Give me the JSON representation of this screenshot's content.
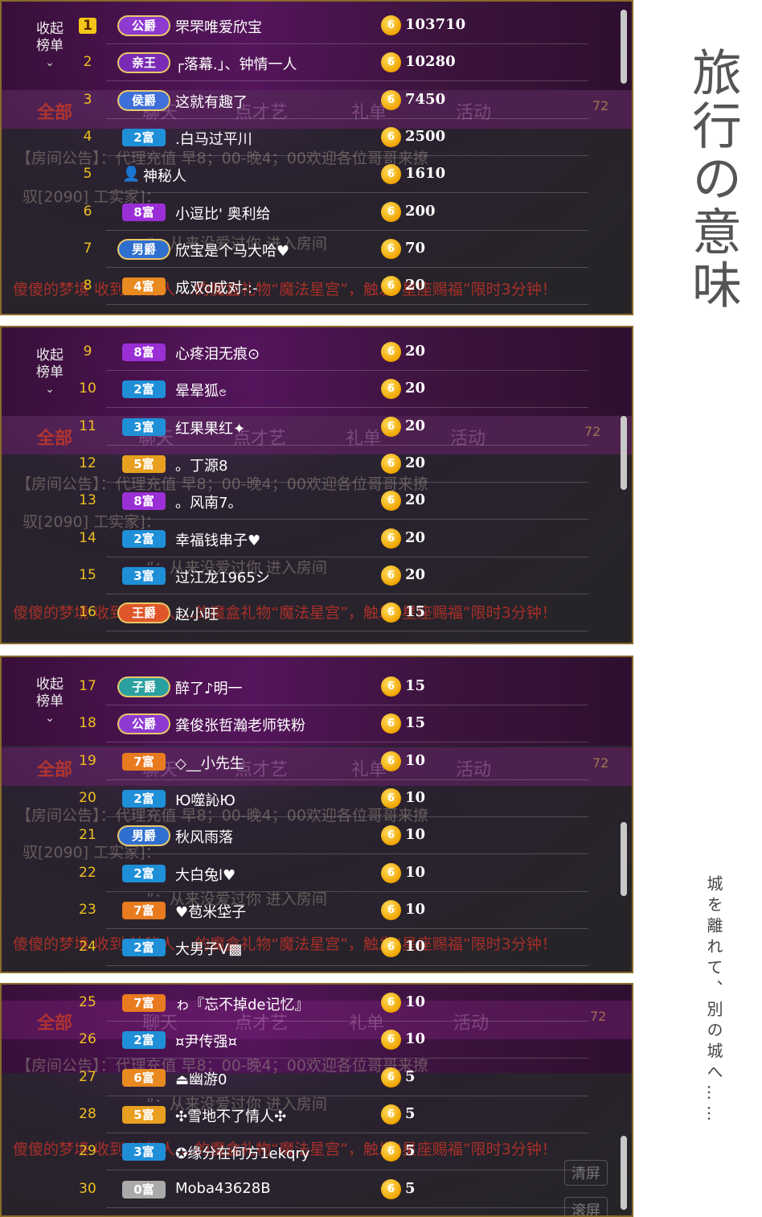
{
  "side": {
    "title": "旅行の意味",
    "subtitle": "城を離れて、別の城へ……"
  },
  "collapse": {
    "line1": "收起",
    "line2": "榜单",
    "chevron": "chevron-down-icon"
  },
  "background_text": {
    "tab_all": "全部",
    "tabs": [
      "聊天",
      "点才艺",
      "礼单",
      "活动"
    ],
    "car_count": "72",
    "announcement": "【房间公告】：代理充值 早8；00-晚4；00欢迎各位哥哥来撩",
    "notice_partial": "驭[2090] 工实家]：",
    "enter_msg": "”：从来没爱过你 进入房间",
    "gift_msg": "傻傻的梦境 收到 神秘人 ...的魔盒礼物“魔法星宫”，触发“星座赐福”限时3分钟！",
    "clear_btn": "清屏",
    "scroll_btn": "滚屏"
  },
  "rows": [
    {
      "rank": "1",
      "badge": "公爵",
      "type": "noble",
      "color": "#8e3ad0",
      "name": "罘罘唯爱欣宝",
      "amount": "103710"
    },
    {
      "rank": "2",
      "badge": "亲王",
      "type": "noble",
      "color": "#7a2bb5",
      "name": "┌落幕.」、钟情一人",
      "amount": "10280"
    },
    {
      "rank": "3",
      "badge": "侯爵",
      "type": "noble",
      "color": "#3f6fd8",
      "name": "这就有趣了",
      "amount": "7450"
    },
    {
      "rank": "4",
      "badge": "2富",
      "type": "rich",
      "color": "#1f8fd8",
      "name": ".白马过平川",
      "amount": "2500"
    },
    {
      "rank": "5",
      "badge": "",
      "type": "mystery",
      "color": "",
      "name": "神秘人",
      "amount": "1610"
    },
    {
      "rank": "6",
      "badge": "8富",
      "type": "rich",
      "color": "#9b2fd6",
      "name": "小逗比' 奥利给",
      "amount": "200"
    },
    {
      "rank": "7",
      "badge": "男爵",
      "type": "noble",
      "color": "#2f6fd0",
      "name": "欣宝是个马大哈♥",
      "amount": "70"
    },
    {
      "rank": "8",
      "badge": "4富",
      "type": "rich",
      "color": "#e88a20",
      "name": "成双d成对-:-",
      "amount": "20"
    },
    {
      "rank": "9",
      "badge": "8富",
      "type": "rich",
      "color": "#9b2fd6",
      "name": "心疼泪无痕⊙",
      "amount": "20"
    },
    {
      "rank": "10",
      "badge": "2富",
      "type": "rich",
      "color": "#1f8fd8",
      "name": "晕晕狐ၔ",
      "amount": "20"
    },
    {
      "rank": "11",
      "badge": "3富",
      "type": "rich",
      "color": "#1f8fd8",
      "name": "红果果红✦",
      "amount": "20"
    },
    {
      "rank": "12",
      "badge": "5富",
      "type": "rich",
      "color": "#e8a020",
      "name": "。丁源8",
      "amount": "20"
    },
    {
      "rank": "13",
      "badge": "8富",
      "type": "rich",
      "color": "#9b2fd6",
      "name": "。风南7。",
      "amount": "20"
    },
    {
      "rank": "14",
      "badge": "2富",
      "type": "rich",
      "color": "#1f8fd8",
      "name": "幸福钱串子♥",
      "amount": "20"
    },
    {
      "rank": "15",
      "badge": "3富",
      "type": "rich",
      "color": "#1f8fd8",
      "name": "过江龙1965シ",
      "amount": "20"
    },
    {
      "rank": "16",
      "badge": "王爵",
      "type": "noble",
      "color": "#e0562a",
      "name": "赵小旺",
      "amount": "15"
    },
    {
      "rank": "17",
      "badge": "子爵",
      "type": "noble",
      "color": "#2aa0a0",
      "name": "醉了♪明一",
      "amount": "15"
    },
    {
      "rank": "18",
      "badge": "公爵",
      "type": "noble",
      "color": "#8e3ad0",
      "name": "龚俊张哲瀚老师铁粉",
      "amount": "15"
    },
    {
      "rank": "19",
      "badge": "7富",
      "type": "rich",
      "color": "#e87a20",
      "name": "◇__小先生",
      "amount": "10"
    },
    {
      "rank": "20",
      "badge": "2富",
      "type": "rich",
      "color": "#1f8fd8",
      "name": "Ю噬訫Ю",
      "amount": "10"
    },
    {
      "rank": "21",
      "badge": "男爵",
      "type": "noble",
      "color": "#2f6fd0",
      "name": "秋风雨落",
      "amount": "10"
    },
    {
      "rank": "22",
      "badge": "2富",
      "type": "rich",
      "color": "#1f8fd8",
      "name": "大白兔l♥",
      "amount": "10"
    },
    {
      "rank": "23",
      "badge": "7富",
      "type": "rich",
      "color": "#e87a20",
      "name": "♥苞米垈子",
      "amount": "10"
    },
    {
      "rank": "24",
      "badge": "2富",
      "type": "rich",
      "color": "#1f8fd8",
      "name": "大男子V▩",
      "amount": "10"
    },
    {
      "rank": "25",
      "badge": "7富",
      "type": "rich",
      "color": "#e87a20",
      "name": "ゎ『忘不掉de记忆』",
      "amount": "10"
    },
    {
      "rank": "26",
      "badge": "2富",
      "type": "rich",
      "color": "#1f8fd8",
      "name": "¤尹传强¤",
      "amount": "10"
    },
    {
      "rank": "27",
      "badge": "6富",
      "type": "rich",
      "color": "#e88a20",
      "name": "⏏幽游0",
      "amount": "5"
    },
    {
      "rank": "28",
      "badge": "5富",
      "type": "rich",
      "color": "#e8a020",
      "name": "✣雪地不了情人✣",
      "amount": "5"
    },
    {
      "rank": "29",
      "badge": "3富",
      "type": "rich",
      "color": "#1f8fd8",
      "name": "✪缘分在何方1ekqry",
      "amount": "5"
    },
    {
      "rank": "30",
      "badge": "0富",
      "type": "rich",
      "color": "#aaaaaa",
      "name": "Moba43628B",
      "amount": "5"
    }
  ]
}
